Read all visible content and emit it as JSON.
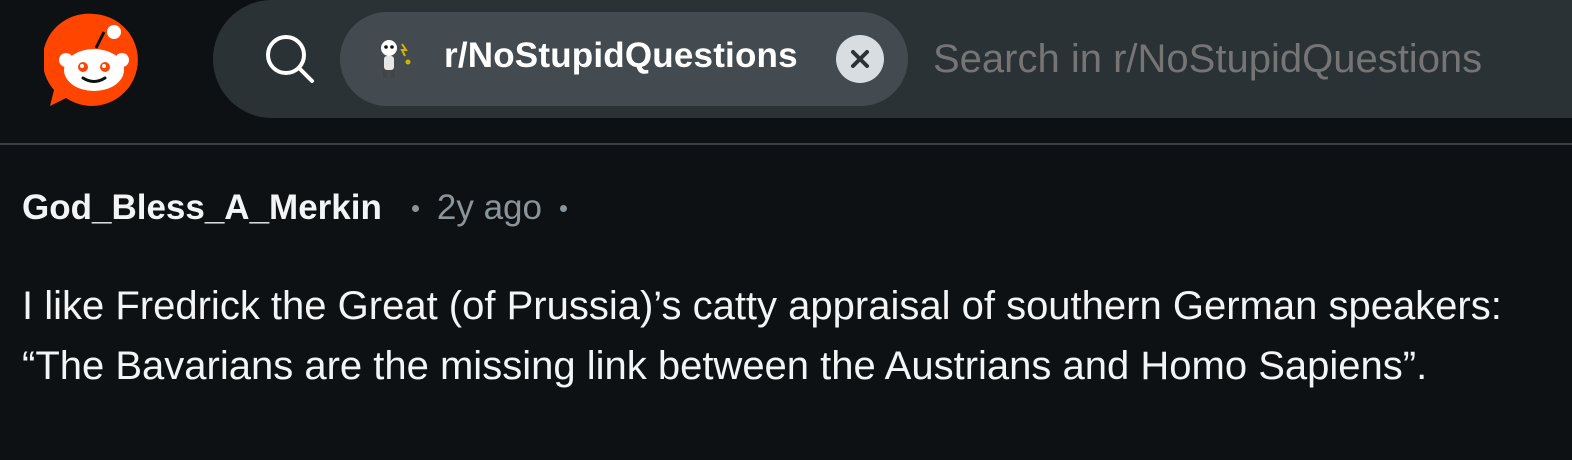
{
  "header": {
    "logo_icon": "reddit-snoo-icon",
    "brand_color": "#ff4500",
    "search": {
      "icon": "search-icon",
      "chip": {
        "avatar_icon": "subreddit-avatar-icon",
        "label": "r/NoStupidQuestions",
        "close_icon": "close-icon"
      },
      "placeholder": "Search in r/NoStupidQuestions"
    }
  },
  "comment": {
    "author": "God_Bless_A_Merkin",
    "age": "2y ago",
    "body": "I like Fredrick the Great (of Prussia)’s catty appraisal of southern German speakers: “The Bavarians are the missing link between the Austrians and Homo Sapiens”."
  }
}
